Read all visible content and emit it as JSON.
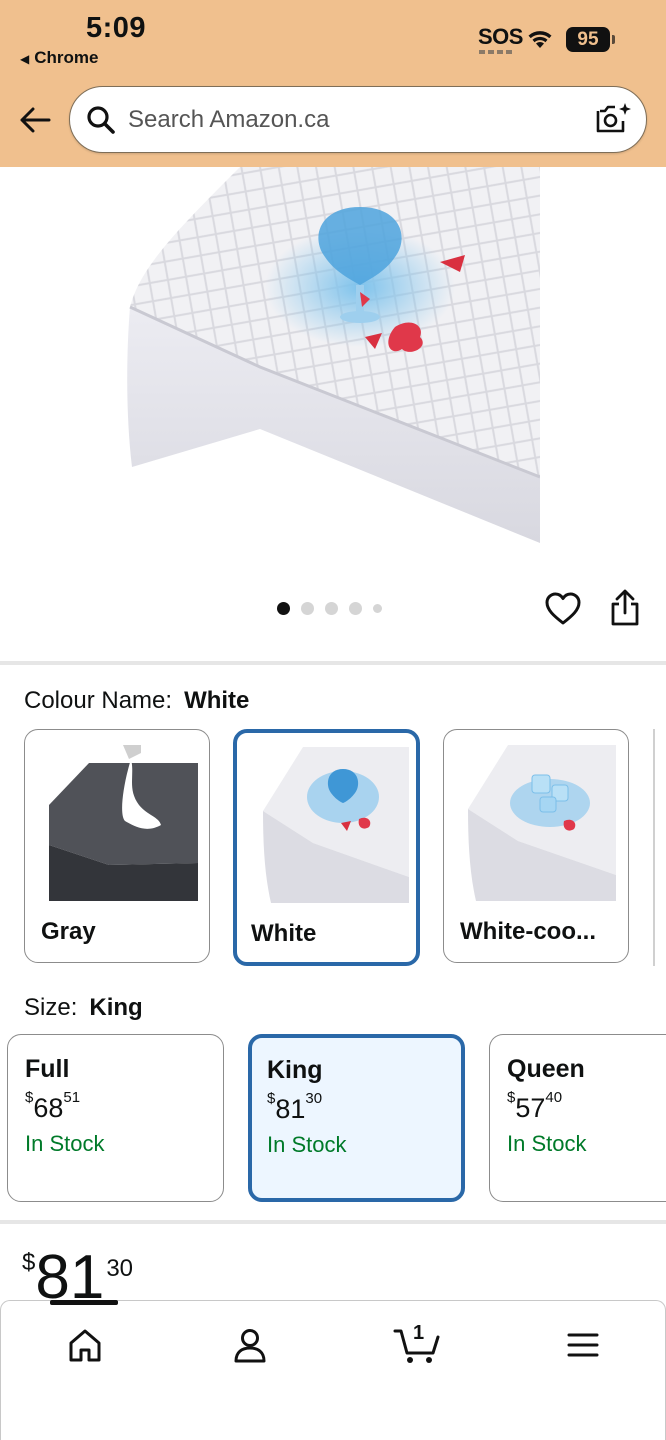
{
  "status_bar": {
    "time": "5:09",
    "back_app": "Chrome",
    "sos": "SOS",
    "battery": "95"
  },
  "search": {
    "placeholder": "Search Amazon.ca"
  },
  "gallery": {
    "image_count": 5,
    "active_index": 0
  },
  "colour": {
    "label": "Colour Name:",
    "selected": "White",
    "options": [
      {
        "name": "Gray"
      },
      {
        "name": "White"
      },
      {
        "name": "White-coo..."
      }
    ]
  },
  "size": {
    "label": "Size:",
    "selected": "King",
    "options": [
      {
        "name": "Full",
        "currency": "$",
        "dollars": "68",
        "cents": "51",
        "stock": "In Stock"
      },
      {
        "name": "King",
        "currency": "$",
        "dollars": "81",
        "cents": "30",
        "stock": "In Stock"
      },
      {
        "name": "Queen",
        "currency": "$",
        "dollars": "57",
        "cents": "40",
        "stock": "In Stock"
      }
    ]
  },
  "price": {
    "currency": "$",
    "dollars": "81",
    "cents": "30"
  },
  "nav": {
    "cart_count": "1",
    "items": [
      "home-icon",
      "account-icon",
      "cart-icon",
      "menu-icon"
    ]
  },
  "colors": {
    "header_bg": "#f0c08e",
    "selected_border": "#2a68a8",
    "in_stock": "#007a29",
    "selected_bg": "#edf6ff"
  }
}
